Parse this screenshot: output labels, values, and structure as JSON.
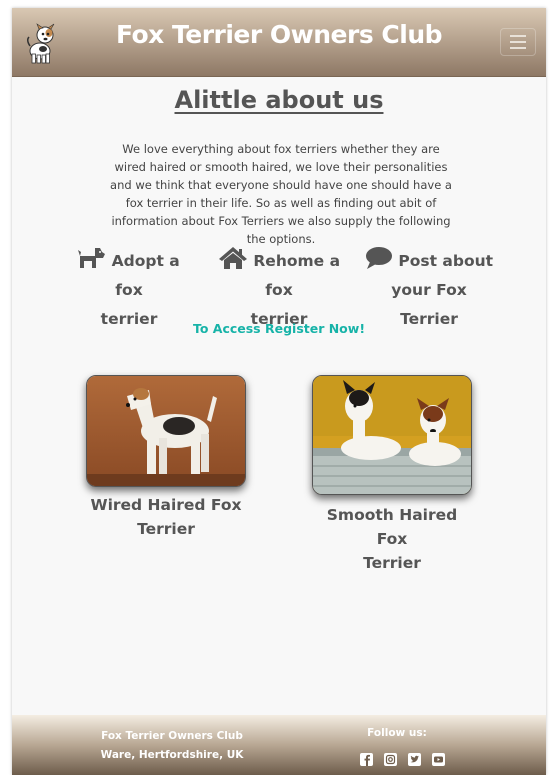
{
  "navbar": {
    "title": "Fox Terrier Owners Club",
    "menu_icon": "hamburger-icon"
  },
  "main": {
    "heading": "Alittle about us",
    "intro": "We love everything about fox terriers whether they are wired haired or smooth haired, we love their personalities and we think that everyone should have one should have a fox terrier in their life. So as well as finding out abit of information about Fox Terriers we also supply the following the options.",
    "options": [
      {
        "icon": "dog-icon",
        "line1": "Adopt a fox",
        "line2": "terrier"
      },
      {
        "icon": "home-icon",
        "line1": "Rehome a fox",
        "line2": "terrier"
      },
      {
        "icon": "comment-icon",
        "line1": "Post about",
        "line2": "your Fox Terrier"
      }
    ],
    "register_link": "To Access Register Now!",
    "cards": [
      {
        "label": "Wired Haired Fox Terrier"
      },
      {
        "label_line1": "Smooth Haired Fox",
        "label_line2": "Terrier"
      }
    ]
  },
  "footer": {
    "club_name": "Fox Terrier Owners Club",
    "location": "Ware, Hertfordshire, UK",
    "follow_label": "Follow us:",
    "social_icons": [
      "facebook-icon",
      "instagram-icon",
      "twitter-icon",
      "youtube-icon"
    ]
  },
  "colors": {
    "accent_link": "#17b3a8",
    "nav_gradient_top": "#d9c8b3",
    "nav_gradient_bottom": "#8e7865"
  }
}
